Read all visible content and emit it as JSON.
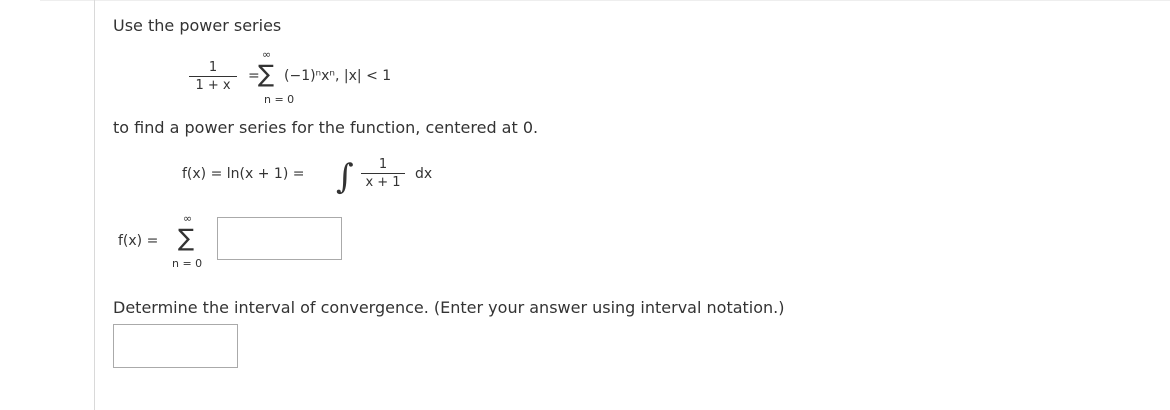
{
  "intro": "Use the power series",
  "series": {
    "lhs_num": "1",
    "lhs_den": "1 + x",
    "eq": "=",
    "upper": "∞",
    "sigma": "∑",
    "lower": "n = 0",
    "term": "(−1)ⁿxⁿ,  |x| < 1"
  },
  "instruction": "to find a power series for the function, centered at 0.",
  "function": {
    "lhs": "f(x)  =  ln(x + 1)  =",
    "integral": "∫",
    "num": "1",
    "den": "x + 1",
    "dx": "dx"
  },
  "answer_series": {
    "lhs": "f(x)  =",
    "upper": "∞",
    "sigma": "∑",
    "lower": "n = 0",
    "input_value": ""
  },
  "question": "Determine the interval of convergence. (Enter your answer using interval notation.)",
  "interval_input_value": ""
}
